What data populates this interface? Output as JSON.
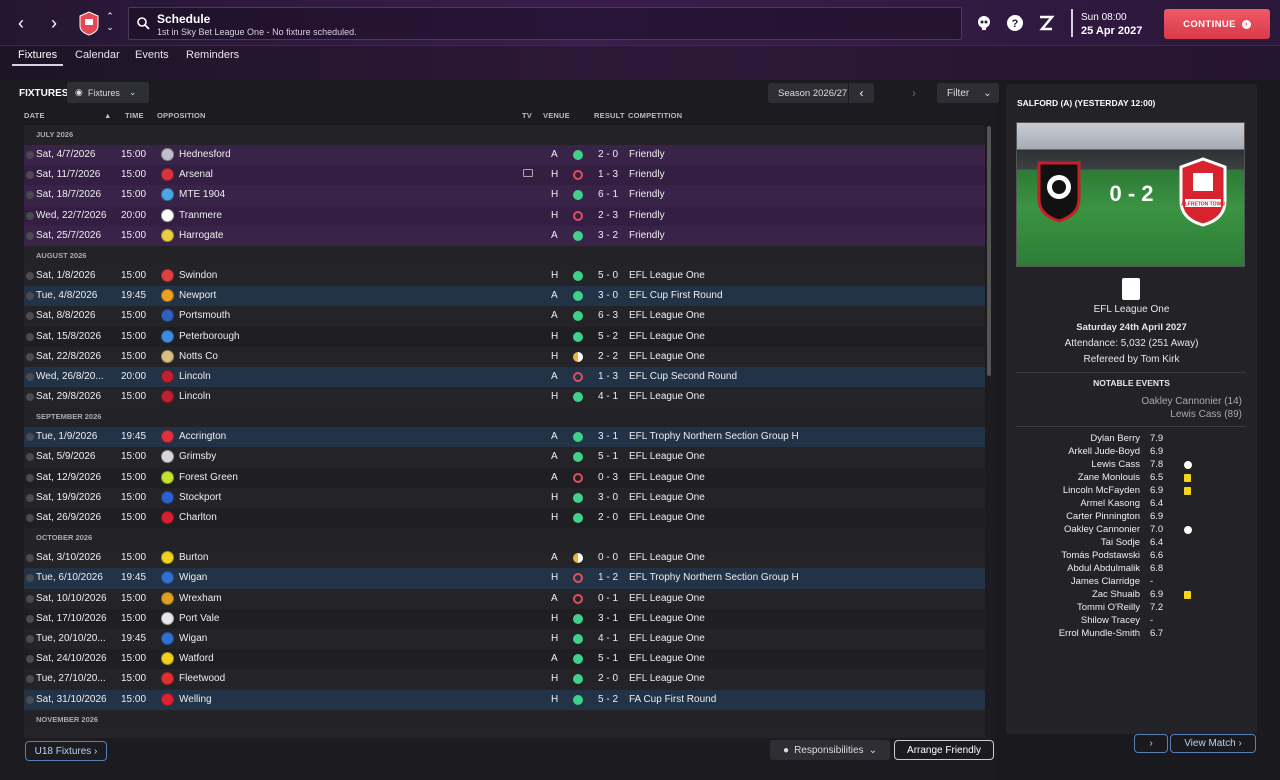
{
  "header": {
    "title": "Schedule",
    "subtitle": "1st in Sky Bet League One - No fixture scheduled.",
    "day_time": "Sun 08:00",
    "date": "25 Apr 2027",
    "continue_label": "CONTINUE",
    "accent": "#e84856"
  },
  "tabs": [
    "Fixtures",
    "Calendar",
    "Events",
    "Reminders"
  ],
  "fixtures_panel": {
    "title": "FIXTURES",
    "view_dropdown": "Fixtures",
    "season": "Season 2026/27",
    "filter": "Filter",
    "columns": [
      "DATE",
      "TIME",
      "OPPOSITION",
      "TV",
      "VENUE",
      "RESULT",
      "COMPETITION"
    ]
  },
  "months": [
    {
      "name": "JULY 2026",
      "rows": [
        {
          "date": "Sat, 4/7/2026",
          "time": "15:00",
          "opp": "Hednesford",
          "tv": false,
          "venue": "A",
          "res": "win",
          "score": "2 - 0",
          "comp": "Friendly",
          "style": "purple",
          "color": "#c0c0c8"
        },
        {
          "date": "Sat, 11/7/2026",
          "time": "15:00",
          "opp": "Arsenal",
          "tv": true,
          "venue": "H",
          "res": "loss",
          "score": "1 - 3",
          "comp": "Friendly",
          "style": "purple alt",
          "color": "#d8343c"
        },
        {
          "date": "Sat, 18/7/2026",
          "time": "15:00",
          "opp": "MTE 1904",
          "tv": false,
          "venue": "H",
          "res": "win",
          "score": "6 - 1",
          "comp": "Friendly",
          "style": "purple",
          "color": "#4aa8e0"
        },
        {
          "date": "Wed, 22/7/2026",
          "time": "20:00",
          "opp": "Tranmere",
          "tv": false,
          "venue": "H",
          "res": "loss",
          "score": "2 - 3",
          "comp": "Friendly",
          "style": "purple alt",
          "color": "#ffffff"
        },
        {
          "date": "Sat, 25/7/2026",
          "time": "15:00",
          "opp": "Harrogate",
          "tv": false,
          "venue": "A",
          "res": "win",
          "score": "3 - 2",
          "comp": "Friendly",
          "style": "purple",
          "color": "#e8d040"
        }
      ]
    },
    {
      "name": "AUGUST 2026",
      "rows": [
        {
          "date": "Sat, 1/8/2026",
          "time": "15:00",
          "opp": "Swindon",
          "tv": false,
          "venue": "H",
          "res": "win",
          "score": "5 - 0",
          "comp": "EFL League One",
          "style": "dark",
          "color": "#e04040"
        },
        {
          "date": "Tue, 4/8/2026",
          "time": "19:45",
          "opp": "Newport",
          "tv": false,
          "venue": "A",
          "res": "win",
          "score": "3 - 0",
          "comp": "EFL Cup First Round",
          "style": "blue",
          "color": "#f0a020"
        },
        {
          "date": "Sat, 8/8/2026",
          "time": "15:00",
          "opp": "Portsmouth",
          "tv": false,
          "venue": "A",
          "res": "win",
          "score": "6 - 3",
          "comp": "EFL League One",
          "style": "dark",
          "color": "#3060c0"
        },
        {
          "date": "Sat, 15/8/2026",
          "time": "15:00",
          "opp": "Peterborough",
          "tv": false,
          "venue": "H",
          "res": "win",
          "score": "5 - 2",
          "comp": "EFL League One",
          "style": "dark alt",
          "color": "#3c8ce0"
        },
        {
          "date": "Sat, 22/8/2026",
          "time": "15:00",
          "opp": "Notts Co",
          "tv": false,
          "venue": "H",
          "res": "draw",
          "score": "2 - 2",
          "comp": "EFL League One",
          "style": "dark",
          "color": "#d8c080"
        },
        {
          "date": "Wed, 26/8/20...",
          "time": "20:00",
          "opp": "Lincoln",
          "tv": false,
          "venue": "A",
          "res": "loss",
          "score": "1 - 3",
          "comp": "EFL Cup Second Round",
          "style": "blue",
          "color": "#c02030"
        },
        {
          "date": "Sat, 29/8/2026",
          "time": "15:00",
          "opp": "Lincoln",
          "tv": false,
          "venue": "H",
          "res": "win",
          "score": "4 - 1",
          "comp": "EFL League One",
          "style": "dark",
          "color": "#c02030"
        }
      ]
    },
    {
      "name": "SEPTEMBER 2026",
      "rows": [
        {
          "date": "Tue, 1/9/2026",
          "time": "19:45",
          "opp": "Accrington",
          "tv": false,
          "venue": "A",
          "res": "win",
          "score": "3 - 1",
          "comp": "EFL Trophy Northern Section Group H",
          "style": "blue",
          "color": "#e03040"
        },
        {
          "date": "Sat, 5/9/2026",
          "time": "15:00",
          "opp": "Grimsby",
          "tv": false,
          "venue": "A",
          "res": "win",
          "score": "5 - 1",
          "comp": "EFL League One",
          "style": "dark",
          "color": "#d8d8d8"
        },
        {
          "date": "Sat, 12/9/2026",
          "time": "15:00",
          "opp": "Forest Green",
          "tv": false,
          "venue": "A",
          "res": "loss",
          "score": "0 - 3",
          "comp": "EFL League One",
          "style": "dark alt",
          "color": "#c8e030"
        },
        {
          "date": "Sat, 19/9/2026",
          "time": "15:00",
          "opp": "Stockport",
          "tv": false,
          "venue": "H",
          "res": "win",
          "score": "3 - 0",
          "comp": "EFL League One",
          "style": "dark",
          "color": "#2a60d0"
        },
        {
          "date": "Sat, 26/9/2026",
          "time": "15:00",
          "opp": "Charlton",
          "tv": false,
          "venue": "H",
          "res": "win",
          "score": "2 - 0",
          "comp": "EFL League One",
          "style": "dark alt",
          "color": "#d82030"
        }
      ]
    },
    {
      "name": "OCTOBER 2026",
      "rows": [
        {
          "date": "Sat, 3/10/2026",
          "time": "15:00",
          "opp": "Burton",
          "tv": false,
          "venue": "A",
          "res": "draw",
          "score": "0 - 0",
          "comp": "EFL League One",
          "style": "dark",
          "color": "#f0d020"
        },
        {
          "date": "Tue, 6/10/2026",
          "time": "19:45",
          "opp": "Wigan",
          "tv": false,
          "venue": "H",
          "res": "loss",
          "score": "1 - 2",
          "comp": "EFL Trophy Northern Section Group H",
          "style": "blue",
          "color": "#3070d0"
        },
        {
          "date": "Sat, 10/10/2026",
          "time": "15:00",
          "opp": "Wrexham",
          "tv": false,
          "venue": "A",
          "res": "loss",
          "score": "0 - 1",
          "comp": "EFL League One",
          "style": "dark",
          "color": "#e0a020"
        },
        {
          "date": "Sat, 17/10/2026",
          "time": "15:00",
          "opp": "Port Vale",
          "tv": false,
          "venue": "H",
          "res": "win",
          "score": "3 - 1",
          "comp": "EFL League One",
          "style": "dark alt",
          "color": "#e8e8e8"
        },
        {
          "date": "Tue, 20/10/20...",
          "time": "19:45",
          "opp": "Wigan",
          "tv": false,
          "venue": "H",
          "res": "win",
          "score": "4 - 1",
          "comp": "EFL League One",
          "style": "dark",
          "color": "#3070d0"
        },
        {
          "date": "Sat, 24/10/2026",
          "time": "15:00",
          "opp": "Watford",
          "tv": false,
          "venue": "A",
          "res": "win",
          "score": "5 - 1",
          "comp": "EFL League One",
          "style": "dark alt",
          "color": "#f0d020"
        },
        {
          "date": "Tue, 27/10/20...",
          "time": "15:00",
          "opp": "Fleetwood",
          "tv": false,
          "venue": "H",
          "res": "win",
          "score": "2 - 0",
          "comp": "EFL League One",
          "style": "dark",
          "color": "#e03030"
        },
        {
          "date": "Sat, 31/10/2026",
          "time": "15:00",
          "opp": "Welling",
          "tv": false,
          "venue": "H",
          "res": "win",
          "score": "5 - 2",
          "comp": "FA Cup First Round",
          "style": "blue",
          "color": "#e02030"
        }
      ]
    },
    {
      "name": "NOVEMBER 2026",
      "rows": []
    }
  ],
  "footer": {
    "u18": "U18 Fixtures",
    "responsibilities": "Responsibilities",
    "arrange": "Arrange Friendly"
  },
  "side": {
    "title": "SALFORD (A) (YESTERDAY 12:00)",
    "score": "0 - 2",
    "away_crest_text": "ALFRETON TOWN",
    "competition": "EFL League One",
    "date": "Saturday 24th April 2027",
    "attendance": "Attendance: 5,032 (251 Away)",
    "referee": "Refereed by  Tom Kirk",
    "notable_title": "NOTABLE EVENTS",
    "scorers": [
      "Oakley Cannonier (14)",
      "Lewis Cass (89)"
    ],
    "ratings": [
      {
        "name": "Dylan Berry",
        "rating": "7.9",
        "event": ""
      },
      {
        "name": "Arkell Jude-Boyd",
        "rating": "6.9",
        "event": ""
      },
      {
        "name": "Lewis Cass",
        "rating": "7.8",
        "event": "goal"
      },
      {
        "name": "Zane Monlouis",
        "rating": "6.5",
        "event": "yellow"
      },
      {
        "name": "Lincoln McFayden",
        "rating": "6.9",
        "event": "yellow"
      },
      {
        "name": "Armel Kasong",
        "rating": "6.4",
        "event": ""
      },
      {
        "name": "Carter Pinnington",
        "rating": "6.9",
        "event": ""
      },
      {
        "name": "Oakley Cannonier",
        "rating": "7.0",
        "event": "goal"
      },
      {
        "name": "Tai Sodje",
        "rating": "6.4",
        "event": ""
      },
      {
        "name": "Tomás Podstawski",
        "rating": "6.6",
        "event": ""
      },
      {
        "name": "Abdul Abdulmalik",
        "rating": "6.8",
        "event": ""
      },
      {
        "name": "James Clarridge",
        "rating": "-",
        "event": ""
      },
      {
        "name": "Zac Shuaib",
        "rating": "6.9",
        "event": "yellow"
      },
      {
        "name": "Tommi O'Reilly",
        "rating": "7.2",
        "event": ""
      },
      {
        "name": "Shilow Tracey",
        "rating": "-",
        "event": ""
      },
      {
        "name": "Errol Mundle-Smith",
        "rating": "6.7",
        "event": ""
      }
    ],
    "next_label": "›",
    "view_match": "View Match"
  }
}
